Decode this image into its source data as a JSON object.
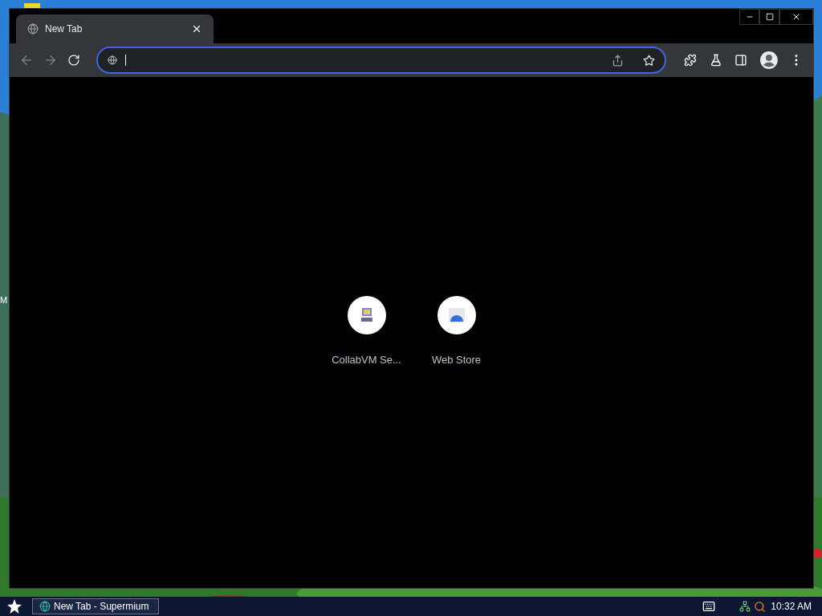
{
  "desktop": {
    "icon_labels": [
      "M"
    ]
  },
  "window": {
    "tabs": [
      {
        "title": "New Tab",
        "selected": true
      }
    ],
    "address_bar": {
      "focused": true
    },
    "shortcuts": [
      {
        "label": "CollabVM Se...",
        "kind": "computer"
      },
      {
        "label": "Web Store",
        "kind": "store"
      }
    ]
  },
  "taskbar": {
    "tasks": [
      {
        "label": "New Tab - Supermium",
        "selected": true
      }
    ],
    "clock": "10:32 AM"
  }
}
